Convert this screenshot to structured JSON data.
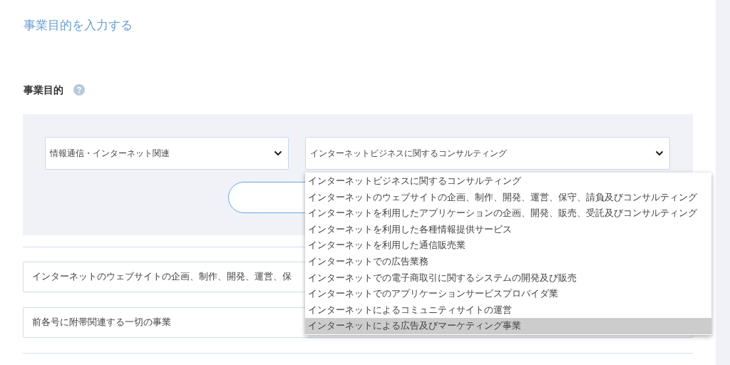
{
  "page_title": "事業目的を入力する",
  "section": {
    "heading": "事業目的"
  },
  "category_select": {
    "value": "情報通信・インターネット関連"
  },
  "purpose_select": {
    "value": "インターネットビジネスに関するコンサルティング",
    "expanded": true,
    "options": [
      {
        "label": "インターネットビジネスに関するコンサルティング",
        "highlighted": false
      },
      {
        "label": "インターネットのウェブサイトの企画、制作、開発、運営、保守、請負及びコンサルティング",
        "highlighted": false
      },
      {
        "label": "インターネットを利用したアプリケーションの企画、開発、販売、受託及びコンサルティング",
        "highlighted": false
      },
      {
        "label": "インターネットを利用した各種情報提供サービス",
        "highlighted": false
      },
      {
        "label": "インターネットを利用した通信販売業",
        "highlighted": false
      },
      {
        "label": "インターネットでの広告業務",
        "highlighted": false
      },
      {
        "label": "インターネットでの電子商取引に関するシステムの開発及び販売",
        "highlighted": false
      },
      {
        "label": "インターネットでのアプリケーションサービスプロバイダ業",
        "highlighted": false
      },
      {
        "label": "インターネットによるコミュニティサイトの運営",
        "highlighted": false
      },
      {
        "label": "インターネットによる広告及びマーケティング事業",
        "highlighted": true
      }
    ]
  },
  "entries": [
    {
      "value": "インターネットのウェブサイトの企画、制作、開発、運営、保"
    },
    {
      "value": "前各号に附帯関連する一切の事業"
    }
  ]
}
